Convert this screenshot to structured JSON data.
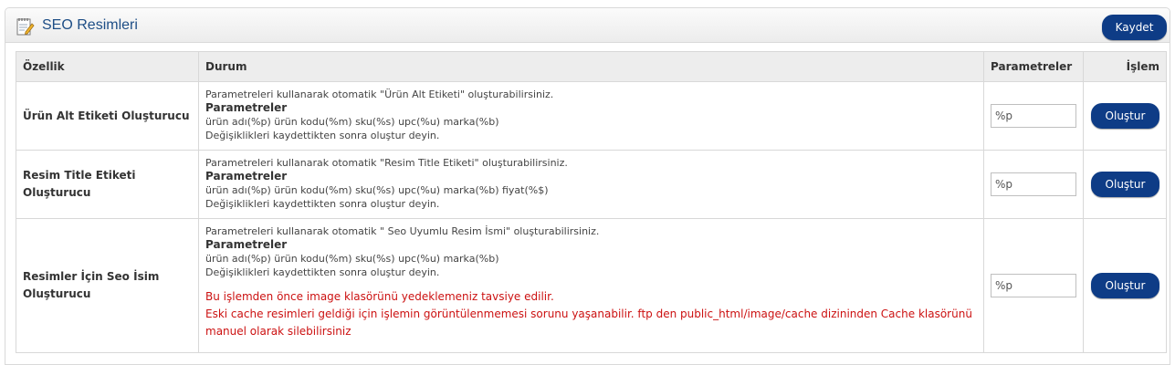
{
  "panel": {
    "title": "SEO Resimleri",
    "icon": "edit-note-icon",
    "save_label": "Kaydet",
    "accent_color": "#0e3c86"
  },
  "table": {
    "headers": {
      "feature": "Özellik",
      "status": "Durum",
      "params": "Parametreler",
      "action": "İşlem"
    },
    "rows": [
      {
        "feature": "Ürün Alt Etiketi Oluşturucu",
        "desc": "Parametreleri kullanarak otomatik \"Ürün Alt Etiketi\" oluşturabilirsiniz.",
        "param_title": "Parametreler",
        "param_list": "ürün adı(%p) ürün kodu(%m) sku(%s) upc(%u) marka(%b)",
        "note": "Değişiklikleri kaydettikten sonra oluştur deyin.",
        "input_value": "%p",
        "button": "Oluştur"
      },
      {
        "feature": "Resim Title Etiketi Oluşturucu",
        "desc": "Parametreleri kullanarak otomatik \"Resim Title Etiketi\" oluşturabilirsiniz.",
        "param_title": "Parametreler",
        "param_list": "ürün adı(%p) ürün kodu(%m) sku(%s) upc(%u) marka(%b) fiyat(%$)",
        "note": "Değişiklikleri kaydettikten sonra oluştur deyin.",
        "input_value": "%p",
        "button": "Oluştur"
      },
      {
        "feature": "Resimler İçin Seo İsim Oluşturucu",
        "desc": "Parametreleri kullanarak otomatik \" Seo Uyumlu Resim İsmi\" oluşturabilirsiniz.",
        "param_title": "Parametreler",
        "param_list": "ürün adı(%p) ürün kodu(%m) sku(%s) upc(%u) marka(%b)",
        "note": "Değişiklikleri kaydettikten sonra oluştur deyin.",
        "warning_1": "Bu işlemden önce image klasörünü yedeklemeniz tavsiye edilir.",
        "warning_2": "Eski cache resimleri geldiği için işlemin görüntülenmemesi sorunu yaşanabilir. ftp den public_html/image/cache dizininden Cache klasörünü manuel olarak silebilirsiniz",
        "input_value": "%p",
        "button": "Oluştur"
      }
    ]
  }
}
